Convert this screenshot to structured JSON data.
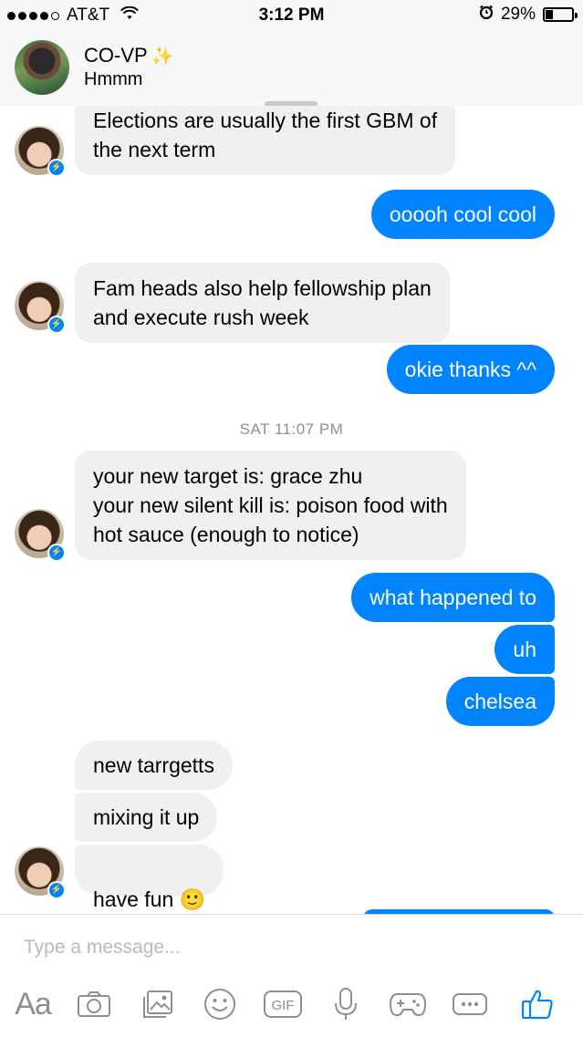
{
  "status_bar": {
    "carrier": "AT&T",
    "time": "3:12 PM",
    "battery": "29%",
    "battery_level": 0.29
  },
  "header": {
    "name": "CO-VP",
    "sparkle": "✨",
    "status": "Hmmm"
  },
  "messages": [
    {
      "dir": "in",
      "text": "Elections are usually the first GBM of\nthe next term"
    },
    {
      "dir": "out",
      "text": "ooooh cool cool"
    },
    {
      "dir": "in",
      "text": "Fam heads also help fellowship plan\nand execute rush week"
    },
    {
      "dir": "out",
      "text": "okie thanks ^^"
    },
    {
      "dir": "in",
      "text": "your new target is: grace zhu\nyour new silent kill is: poison food with\nhot sauce (enough to notice)"
    },
    {
      "dir": "out",
      "text": "what happened to"
    },
    {
      "dir": "out",
      "text": "uh"
    },
    {
      "dir": "out",
      "text": "chelsea"
    },
    {
      "dir": "in",
      "text": "new tarrgetts"
    },
    {
      "dir": "in",
      "text": "mixing it up"
    },
    {
      "dir": "in",
      "text": "have fun",
      "emoji": "🙂"
    }
  ],
  "timestamp": "SAT 11:07 PM",
  "composer": {
    "placeholder": "Type a message...",
    "tools": [
      "text-format",
      "camera",
      "gallery",
      "emoji",
      "gif",
      "microphone",
      "games",
      "more",
      "like"
    ],
    "text_tool": "Aa",
    "gif_label": "GIF"
  },
  "colors": {
    "accent": "#0084ff",
    "incoming_bubble": "#f1f0f0",
    "muted": "#8e8e93"
  }
}
